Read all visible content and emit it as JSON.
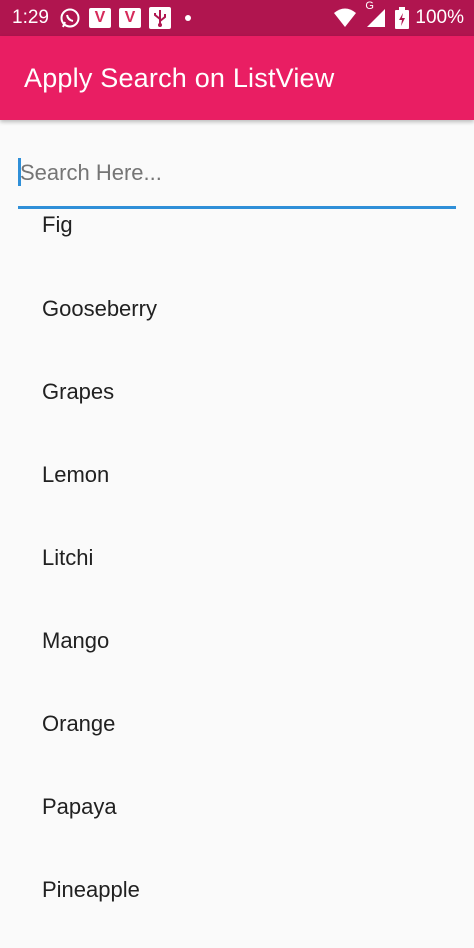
{
  "status_bar": {
    "time": "1:29",
    "icons": [
      "whatsapp-icon",
      "vivaldi-icon",
      "vivaldi-icon",
      "usb-icon",
      "dot-icon",
      "wifi-icon",
      "signal-icon",
      "battery-icon"
    ],
    "v_label": "V",
    "network_label": "G",
    "battery": "100%"
  },
  "app_bar": {
    "title": "Apply Search on ListView",
    "color": "#e91e63"
  },
  "search": {
    "placeholder": "Search Here...",
    "value": "",
    "underline_color": "#2f8fd8"
  },
  "list": {
    "items": [
      "Fig",
      "Gooseberry",
      "Grapes",
      "Lemon",
      "Litchi",
      "Mango",
      "Orange",
      "Papaya",
      "Pineapple"
    ]
  }
}
